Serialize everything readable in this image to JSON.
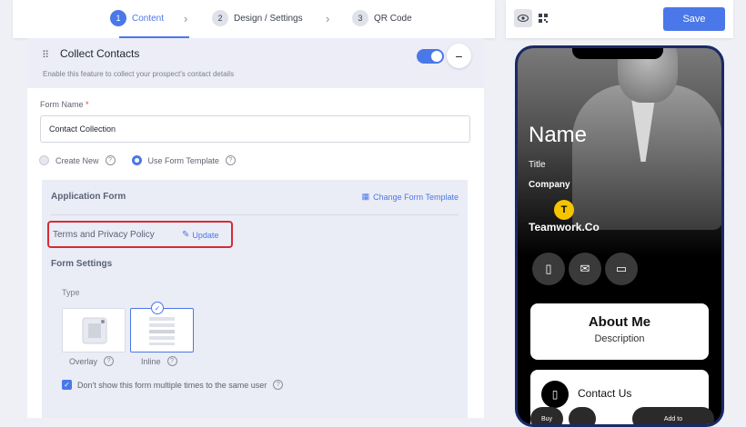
{
  "stepper": {
    "steps": [
      {
        "num": "1",
        "label": "Content"
      },
      {
        "num": "2",
        "label": "Design / Settings"
      },
      {
        "num": "3",
        "label": "QR Code"
      }
    ]
  },
  "collect": {
    "title": "Collect Contacts",
    "subtitle": "Enable this feature to collect your prospect's contact details",
    "enabled": true
  },
  "form": {
    "name_label": "Form Name",
    "required_mark": "*",
    "name_value": "Contact Collection",
    "options": [
      "Create New",
      "Use Form Template"
    ],
    "selected_option": "Use Form Template"
  },
  "app_form": {
    "title": "Application Form",
    "change_template": "Change Form Template",
    "terms_label": "Terms and Privacy Policy",
    "update_label": "Update",
    "settings_title": "Form Settings",
    "type_label": "Type",
    "types": [
      "Overlay",
      "Inline"
    ],
    "selected_type": "Inline",
    "checkbox_label": "Don't show this form multiple times to the same user",
    "checkbox_checked": true
  },
  "preview": {
    "save_label": "Save",
    "name": "Name",
    "title": "Title",
    "company": "Company",
    "logo_letter": "T",
    "brand": "Teamwork.Co",
    "about_title": "About Me",
    "about_desc": "Description",
    "contact_label": "Contact Us",
    "fab_left": "Buy",
    "fab_right": "Add to"
  },
  "colors": {
    "accent": "#4a78e8",
    "highlight": "#d62b34"
  }
}
